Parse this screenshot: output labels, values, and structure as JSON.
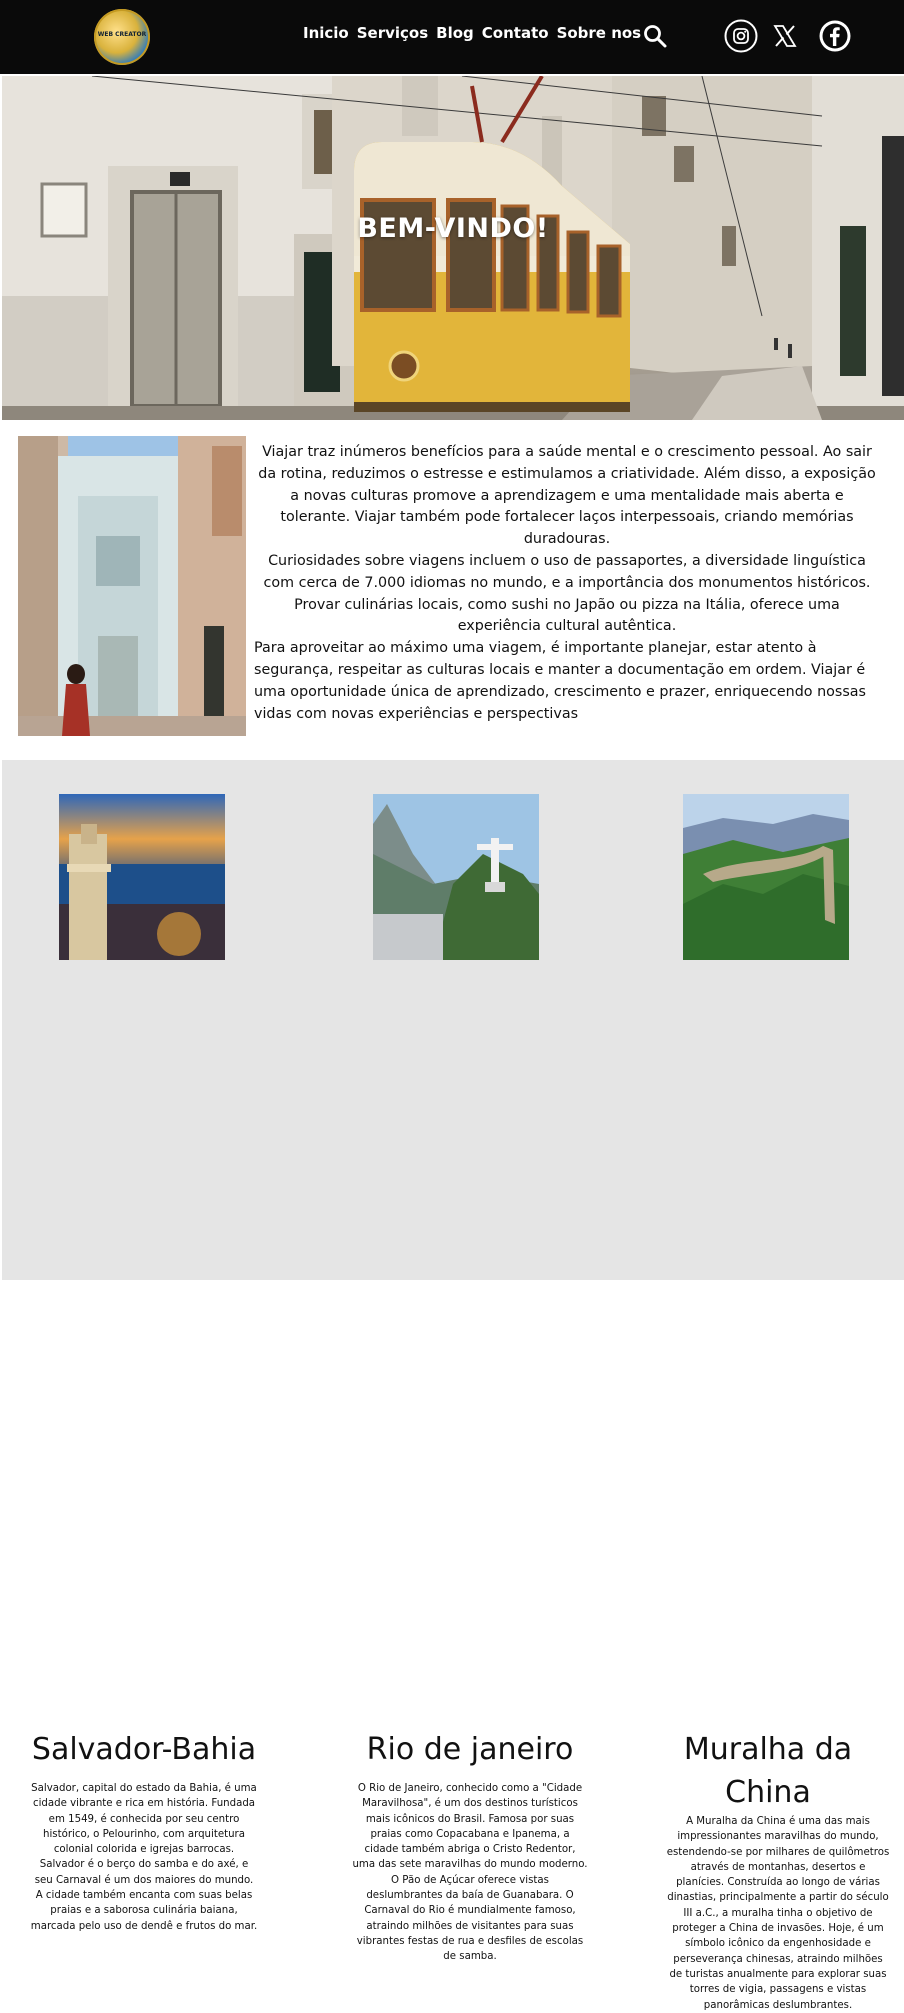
{
  "nav": {
    "logo_text": "WEB CREATOR",
    "menu": [
      "Inicio",
      "Serviços",
      "Blog",
      "Contato",
      "Sobre nos"
    ],
    "icons": [
      "search-icon",
      "instagram-icon",
      "x-icon",
      "facebook-icon"
    ]
  },
  "hero": {
    "title": "BEM-VINDO!"
  },
  "intro": {
    "paragraph_1": "Viajar traz inúmeros benefícios para a saúde mental e o crescimento pessoal. Ao sair da rotina, reduzimos o estresse e estimulamos a criatividade. Além disso, a exposição a novas culturas promove a aprendizagem e uma mentalidade mais aberta e tolerante. Viajar também pode fortalecer laços interpessoais, criando memórias duradouras.",
    "paragraph_2": "Curiosidades sobre viagens incluem o uso de passaportes, a diversidade linguística com cerca de 7.000 idiomas no mundo, e a importância dos monumentos históricos. Provar culinárias locais, como sushi no Japão ou pizza na Itália, oferece uma experiência cultural autêntica.",
    "paragraph_3": "Para aproveitar ao máximo uma viagem, é importante planejar, estar atento à segurança, respeitar as culturas locais e manter a documentação em ordem. Viajar é uma oportunidade única de aprendizado, crescimento e prazer, enriquecendo nossas vidas com novas experiências e perspectivas"
  },
  "destinations": [
    {
      "title": "Salvador-Bahia",
      "text": "Salvador, capital do estado da Bahia, é uma cidade vibrante e rica em história. Fundada em 1549, é conhecida por seu centro histórico, o Pelourinho, com arquitetura colonial colorida e igrejas barrocas. Salvador é o berço do samba e do axé, e seu Carnaval é um dos maiores do mundo. A cidade também encanta com suas belas praias e a saborosa culinária baiana, marcada pelo uso de dendê e frutos do mar."
    },
    {
      "title": "Rio de janeiro",
      "text": "O Rio de Janeiro, conhecido como a \"Cidade Maravilhosa\", é um dos destinos turísticos mais icônicos do Brasil. Famosa por suas praias como Copacabana e Ipanema, a cidade também abriga o Cristo Redentor, uma das sete maravilhas do mundo moderno. O Pão de Açúcar oferece vistas deslumbrantes da baía de Guanabara. O Carnaval do Rio é mundialmente famoso, atraindo milhões de visitantes para suas vibrantes festas de rua e desfiles de escolas de samba."
    },
    {
      "title": "Muralha da China",
      "text": "A Muralha da China é uma das mais impressionantes maravilhas do mundo, estendendo-se por milhares de quilômetros através de montanhas, desertos e planícies. Construída ao longo de várias dinastias, principalmente a partir do século III a.C., a muralha tinha o objetivo de proteger a China de invasões. Hoje, é um símbolo icônico da engenhosidade e perseverança chinesas, atraindo milhões de turistas anualmente para explorar suas torres de vigia, passagens e vistas panorâmicas deslumbrantes."
    }
  ],
  "colors": {
    "nav_bg": "#0a0a0a",
    "section_bg": "#e5e5e5",
    "tram_yellow": "#e2b53a"
  }
}
